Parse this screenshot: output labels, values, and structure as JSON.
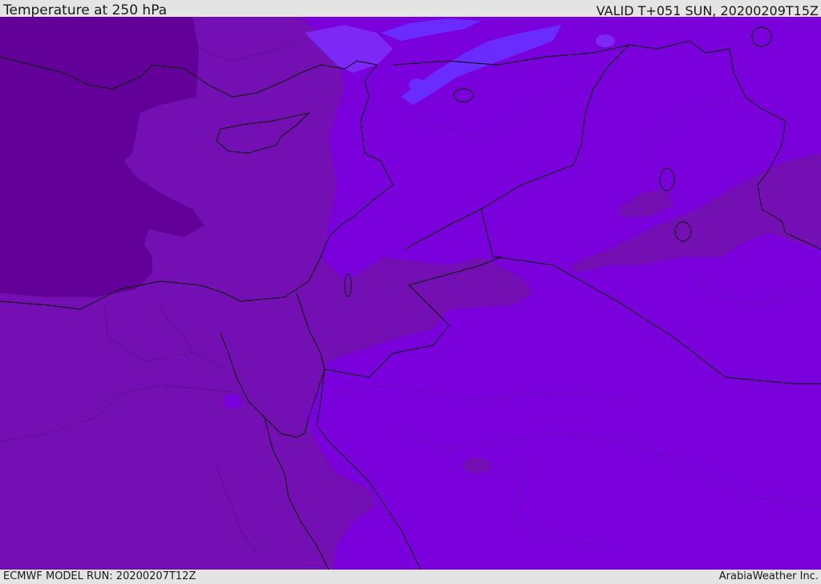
{
  "header": {
    "title": "Temperature at 250 hPa",
    "valid_time": "VALID T+051 SUN, 20200209T15Z"
  },
  "footer": {
    "model_run": "ECMWF MODEL RUN: 20200207T12Z",
    "credit": "ArabiaWeather Inc."
  },
  "colors": {
    "coldest": "#630099",
    "cold": "#7410B3",
    "cool": "#7A00DC",
    "warmer_patch": "#7D28F5",
    "warmest_patch": "#6A2BFF",
    "boundaries": "#000000",
    "frame": "#e4e4e4"
  }
}
